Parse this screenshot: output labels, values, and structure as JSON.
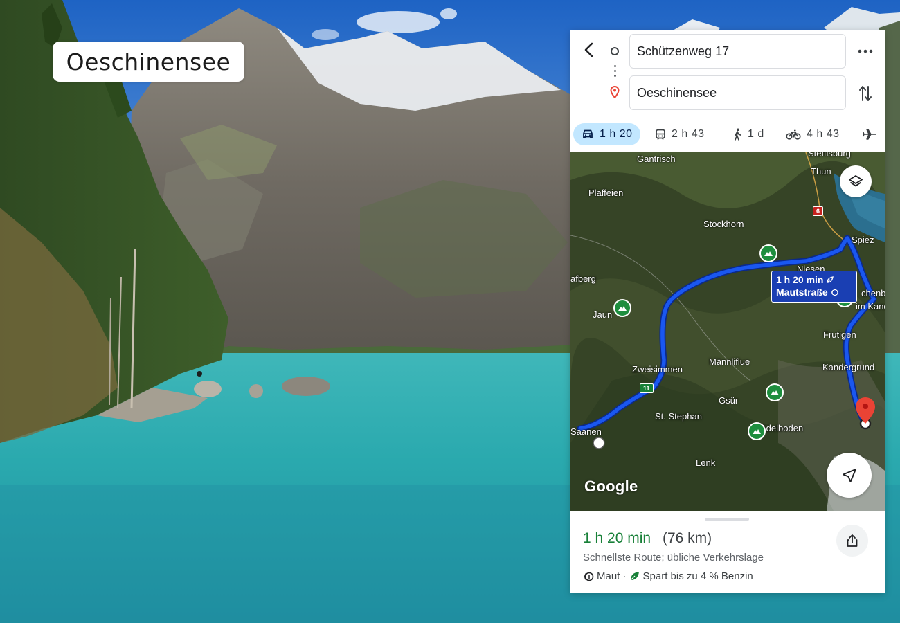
{
  "overlay": {
    "title": "Oeschinensee"
  },
  "directions": {
    "origin_value": "Schützenweg 17",
    "destination_value": "Oeschinensee",
    "modes": [
      {
        "name": "car",
        "label": "1 h 20",
        "active": true
      },
      {
        "name": "transit",
        "label": "2 h 43",
        "active": false
      },
      {
        "name": "walk",
        "label": "1 d",
        "active": false
      },
      {
        "name": "bike",
        "label": "4 h 43",
        "active": false
      },
      {
        "name": "flight",
        "label": "",
        "active": false
      }
    ]
  },
  "map": {
    "labels": {
      "gantrisch": "Gantrisch",
      "plaffeien": "Plaffeien",
      "stockhorn": "Stockhorn",
      "thun": "Thun",
      "steffisburg": "Steffisburg",
      "spiez": "Spiez",
      "niesen": "Niesen",
      "kafberg": "afberg",
      "reichenbach": "chenb",
      "kandergrund_region": "im Kande",
      "jaun": "Jaun",
      "frutigen": "Frutigen",
      "zweisimmen": "Zweisimmen",
      "maennliflue": "Männliflue",
      "kandergrund": "Kandergrund",
      "gsuer": "Gsür",
      "st_stephan": "St. Stephan",
      "adelboden": "Adelboden",
      "saanen": "Saanen",
      "lenk": "Lenk"
    },
    "badges": {
      "hwy6": "6",
      "hwy11": "11"
    },
    "callout": {
      "time": "1 h 20 min",
      "note": "Mautstraße"
    },
    "logo": "Google"
  },
  "summary": {
    "time": "1 h 20 min",
    "distance": "(76 km)",
    "subtitle": "Schnellste Route; übliche Verkehrslage",
    "toll": "Maut ·",
    "fuel": "Spart bis zu 4 % Benzin"
  },
  "colors": {
    "route": "#1a57f0",
    "eta_green": "#188038",
    "active_mode_bg": "#c2e7ff",
    "pin_red": "#ea4335"
  }
}
